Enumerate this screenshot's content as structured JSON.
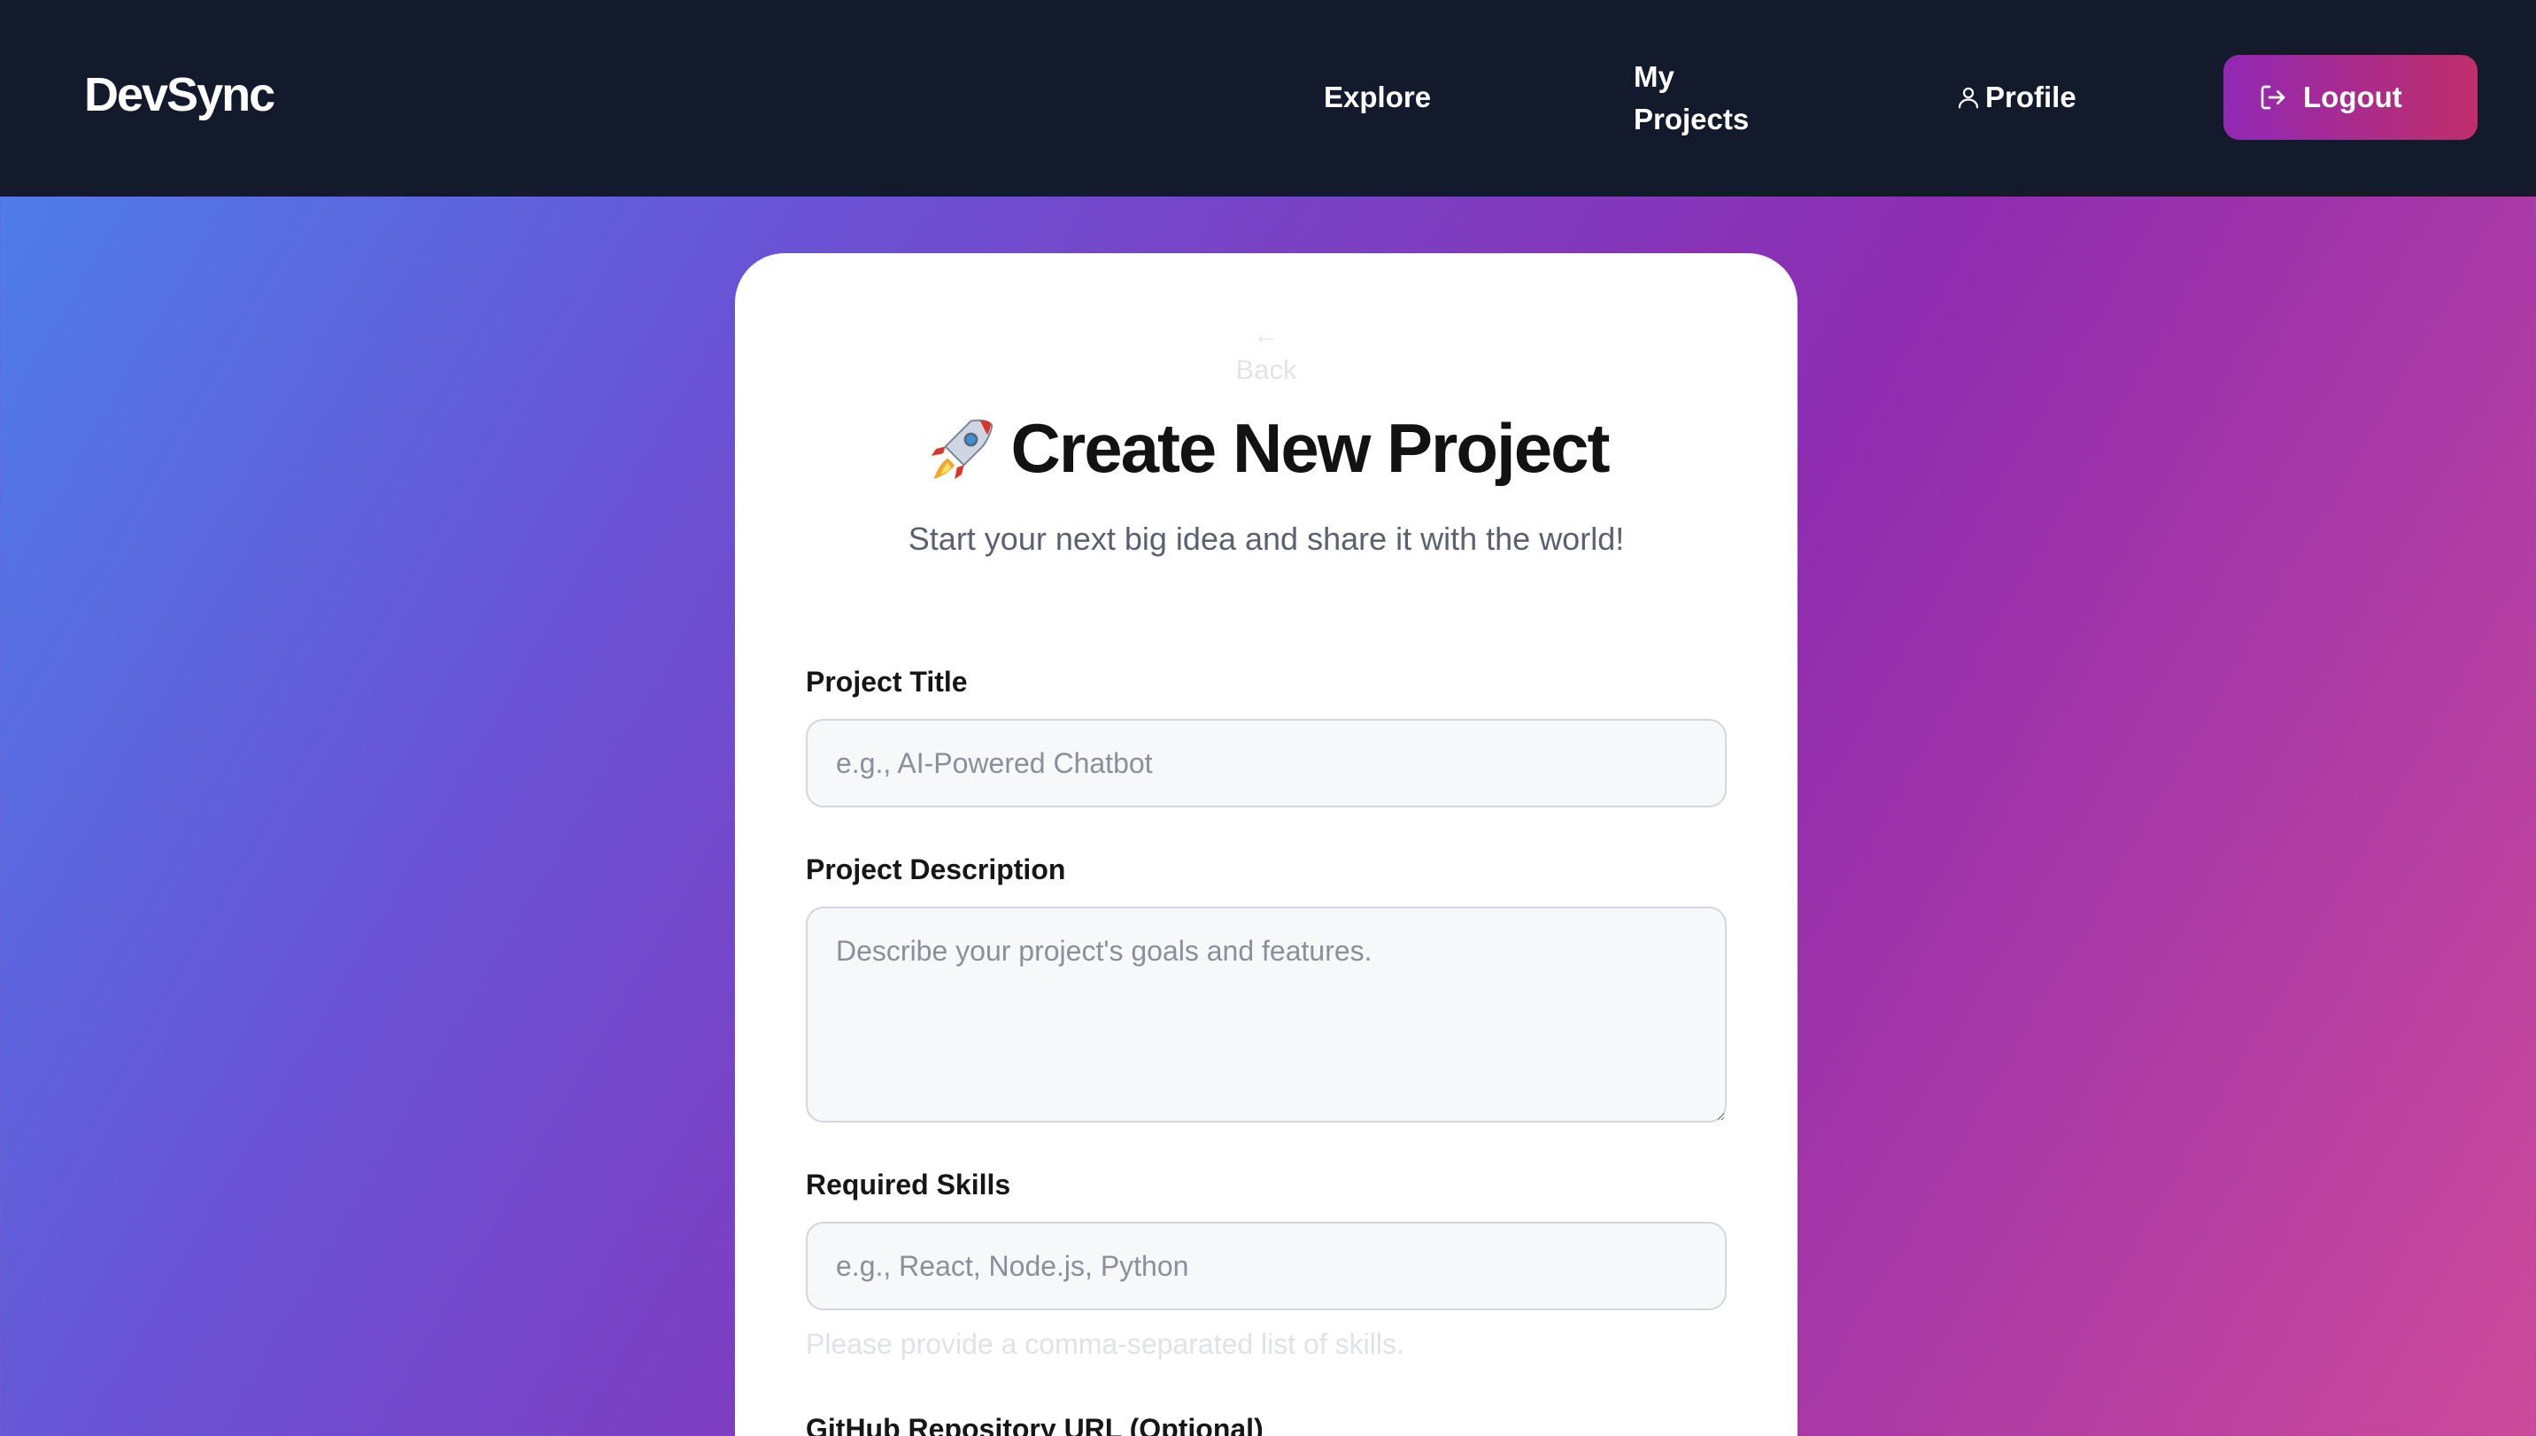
{
  "navbar": {
    "brand": "DevSync",
    "links": {
      "explore": "Explore",
      "my_projects": "My Projects",
      "profile": "Profile"
    },
    "logout_label": "Logout",
    "icons": {
      "profile": "user-icon",
      "logout": "logout-icon"
    }
  },
  "card": {
    "back_label": "Back",
    "title_emoji": "🚀",
    "title": "Create New Project",
    "subtitle": "Start your next big idea and share it with the world!"
  },
  "form": {
    "title": {
      "label": "Project Title",
      "placeholder": "e.g., AI-Powered Chatbot",
      "value": ""
    },
    "description": {
      "label": "Project Description",
      "placeholder": "Describe your project's goals and features.",
      "value": ""
    },
    "skills": {
      "label": "Required Skills",
      "placeholder": "e.g., React, Node.js, Python",
      "value": "",
      "helper": "Please provide a comma-separated list of skills."
    },
    "github": {
      "label": "GitHub Repository URL (Optional)"
    }
  },
  "colors": {
    "navbar_bg": "#121a2c",
    "gradient_start": "#4a82ec",
    "gradient_end": "#cc4a9a",
    "logout_start": "#9128b4",
    "logout_end": "#c02e6a"
  }
}
